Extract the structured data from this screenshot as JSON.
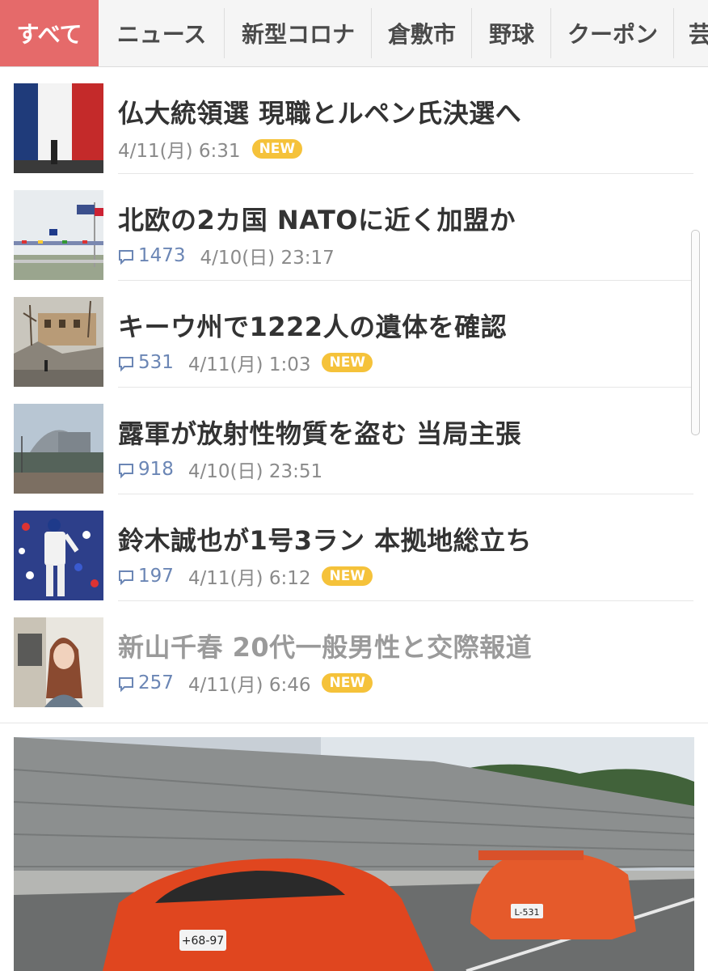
{
  "tabs": [
    {
      "label": "すべて",
      "active": true
    },
    {
      "label": "ニュース",
      "active": false
    },
    {
      "label": "新型コロナ",
      "active": false
    },
    {
      "label": "倉敷市",
      "active": false
    },
    {
      "label": "野球",
      "active": false
    },
    {
      "label": "クーポン",
      "active": false
    },
    {
      "label": "芸",
      "active": false
    }
  ],
  "news": [
    {
      "title": "仏大統領選 現職とルペン氏決選へ",
      "comments": "",
      "date": "4/11(月) 6:31",
      "new_badge": "NEW",
      "thumb_icon": "french-flags-photo"
    },
    {
      "title": "北欧の2カ国 NATOに近く加盟か",
      "comments": "1473",
      "date": "4/10(日) 23:17",
      "new_badge": "",
      "thumb_icon": "nato-flags-photo"
    },
    {
      "title": "キーウ州で1222人の遺体を確認",
      "comments": "531",
      "date": "4/11(月) 1:03",
      "new_badge": "NEW",
      "thumb_icon": "destroyed-building-photo"
    },
    {
      "title": "露軍が放射性物質を盗む 当局主張",
      "comments": "918",
      "date": "4/10(日) 23:51",
      "new_badge": "",
      "thumb_icon": "chernobyl-dome-photo"
    },
    {
      "title": "鈴木誠也が1号3ラン 本拠地総立ち",
      "comments": "197",
      "date": "4/11(月) 6:12",
      "new_badge": "NEW",
      "thumb_icon": "baseball-player-photo"
    },
    {
      "title": "新山千春 20代一般男性と交際報道",
      "comments": "257",
      "date": "4/11(月) 6:46",
      "new_badge": "NEW",
      "thumb_icon": "woman-portrait-photo",
      "visited": true
    }
  ],
  "banner": {
    "icon": "sports-cars-highway-photo",
    "plates": [
      "+68-97",
      "L-531"
    ]
  },
  "colors": {
    "active_tab": "#e56a6a",
    "new_badge": "#f5c23a",
    "comment_count": "#6b86b5",
    "title": "#333333",
    "visited_title": "#9a9a9a"
  }
}
